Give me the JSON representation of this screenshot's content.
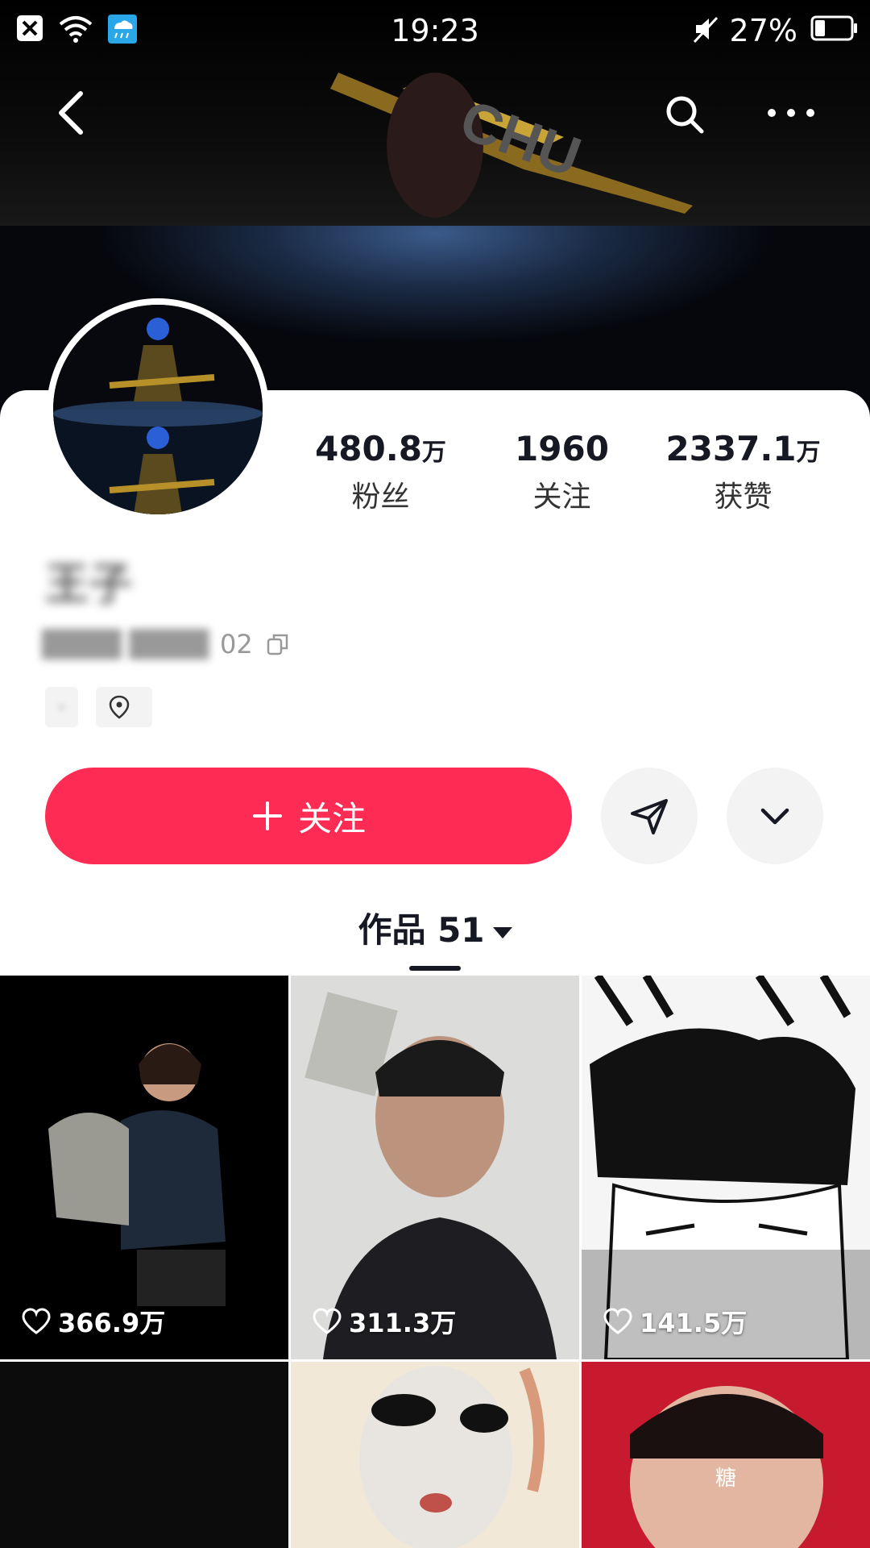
{
  "status_bar": {
    "time": "19:23",
    "battery": "27%"
  },
  "stats": [
    {
      "number": "480.8",
      "unit": "万",
      "label": "粉丝"
    },
    {
      "number": "1960",
      "unit": "",
      "label": "关注"
    },
    {
      "number": "2337.1",
      "unit": "万",
      "label": "获赞"
    }
  ],
  "profile": {
    "name": "王子",
    "account_id": "02",
    "tag_1": "·",
    "tag_2": ""
  },
  "actions": {
    "follow_label": "关注"
  },
  "works_tab": {
    "label": "作品 51"
  },
  "grid": [
    {
      "likes": "366.9万"
    },
    {
      "likes": "311.3万"
    },
    {
      "likes": "141.5万"
    },
    {
      "caption": ""
    },
    {
      "caption": ""
    },
    {
      "caption": "糖"
    }
  ],
  "colors": {
    "accent": "#fe2c55",
    "text": "#161823",
    "button_bg": "#f3f3f4"
  },
  "icons": [
    "close-notification-icon",
    "wifi-icon",
    "weather-icon",
    "mute-icon",
    "battery-icon",
    "back-icon",
    "search-icon",
    "more-icon",
    "copy-icon",
    "location-icon",
    "plus-icon",
    "share-send-icon",
    "chevron-down-icon",
    "heart-icon"
  ]
}
